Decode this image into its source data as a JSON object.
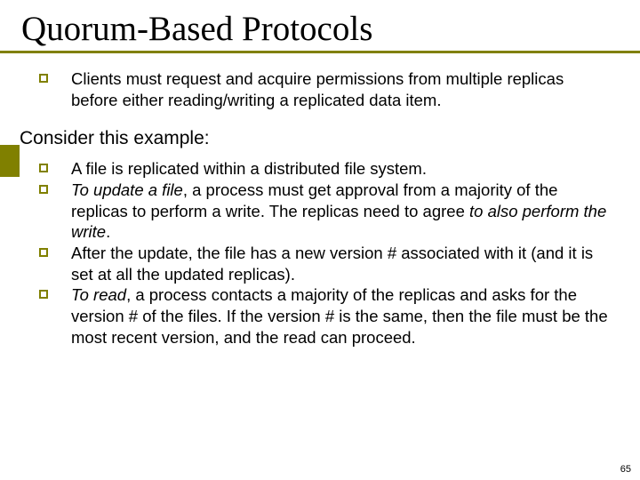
{
  "title": "Quorum-Based Protocols",
  "intro": {
    "b1": "Clients must request and acquire permissions from multiple replicas before either reading/writing a replicated data item."
  },
  "subhead": "Consider this example:",
  "ex": {
    "b1": "A file is replicated within a distributed file system.",
    "b2a": "To update a file",
    "b2b": ", a process must get approval from a majority of the replicas to perform a write. The replicas need to agree ",
    "b2c": "to also perform the write",
    "b2d": ".",
    "b3": "After the update, the file has a new version # associated with it (and it is set at all the updated replicas).",
    "b4a": "To read",
    "b4b": ", a process contacts a majority of the replicas and asks for the version # of the files. If the version # is the same, then the file must be the most recent version, and the read can proceed."
  },
  "page": "65"
}
